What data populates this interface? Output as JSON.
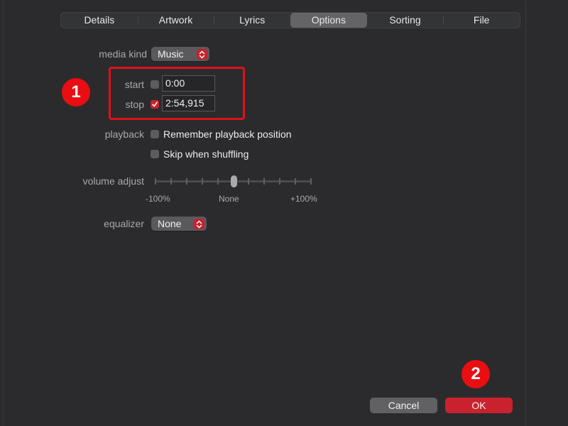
{
  "tabs": [
    {
      "label": "Details",
      "active": false
    },
    {
      "label": "Artwork",
      "active": false
    },
    {
      "label": "Lyrics",
      "active": false
    },
    {
      "label": "Options",
      "active": true
    },
    {
      "label": "Sorting",
      "active": false
    },
    {
      "label": "File",
      "active": false
    }
  ],
  "media_kind": {
    "label": "media kind",
    "value": "Music"
  },
  "start": {
    "label": "start",
    "checked": false,
    "value": "0:00"
  },
  "stop": {
    "label": "stop",
    "checked": true,
    "value": "2:54,915"
  },
  "playback": {
    "label": "playback",
    "remember_position": {
      "label": "Remember playback position",
      "checked": false
    },
    "skip_shuffling": {
      "label": "Skip when shuffling",
      "checked": false
    }
  },
  "volume_adjust": {
    "label": "volume adjust",
    "min_label": "-100%",
    "mid_label": "None",
    "max_label": "+100%",
    "value_percent": 0,
    "tick_count": 11
  },
  "equalizer": {
    "label": "equalizer",
    "value": "None"
  },
  "annotations": {
    "step1": "1",
    "step2": "2"
  },
  "buttons": {
    "cancel": "Cancel",
    "ok": "OK"
  },
  "colors": {
    "accent": "#c9222e",
    "annotation": "#e80e12"
  }
}
